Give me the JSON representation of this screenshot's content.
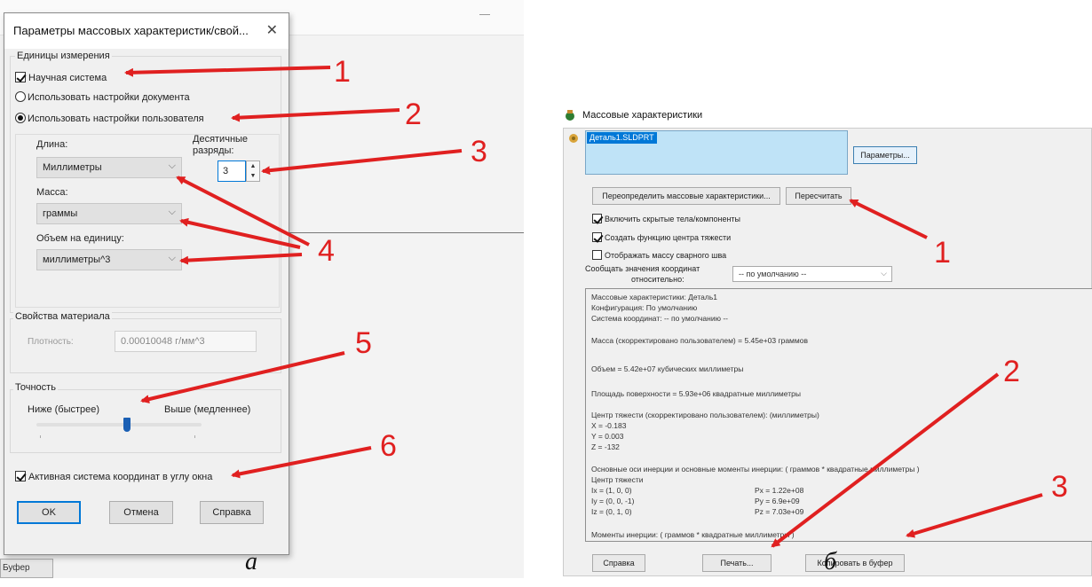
{
  "panel_a": {
    "dialog_title": "Параметры массовых характеристик/свой...",
    "close_glyph": "✕",
    "units_group_label": "Единицы измерения",
    "scientific_label": "Научная система",
    "use_document_label": "Использовать настройки документа",
    "use_user_label": "Использовать настройки пользователя",
    "length_label": "Длина:",
    "decimals_label_1": "Десятичные",
    "decimals_label_2": "разряды:",
    "length_value": "Миллиметры",
    "decimals_value": "3",
    "mass_label": "Масса:",
    "mass_value": "граммы",
    "volume_label": "Объем на единицу:",
    "volume_value": "миллиметры^3",
    "material_group_label": "Свойства материала",
    "density_label": "Плотность:",
    "density_value": "0.00010048 г/мм^3",
    "accuracy_group_label": "Точность",
    "lower_label": "Ниже (быстрее)",
    "higher_label": "Выше (медленнее)",
    "accuracy_level": 0.55,
    "active_cs_label": "Активная система координат в углу окна",
    "ok_label": "OK",
    "cancel_label": "Отмена",
    "help_label": "Справка",
    "background_button": "Буфер"
  },
  "panel_b": {
    "window_title": "Массовые характеристики",
    "selected_item": "Деталь1.SLDPRT",
    "params_button": "Параметры...",
    "override_button": "Переопределить массовые характеристики...",
    "recalc_button": "Пересчитать",
    "include_hidden_label": "Включить скрытые тела/компоненты",
    "create_cog_label": "Создать функцию центра тяжести",
    "show_weld_label": "Отображать массу сварного шва",
    "report_coord_label_1": "Сообщать значения координат",
    "report_coord_label_2": "относительно:",
    "coord_system_value": "-- по умолчанию --",
    "results": [
      "Массовые характеристики: Деталь1",
      "     Конфигурация: По умолчанию",
      "     Система координат: -- по умолчанию --",
      "Масса (скорректировано пользователем) = 5.45e+03 граммов",
      "Объем = 5.42e+07 кубических миллиметры",
      "Площадь поверхности = 5.93e+06  квадратные миллиметры",
      "Центр тяжести (скорректировано пользователем): (миллиметры)",
      "     X = -0.183",
      "     Y = 0.003",
      "     Z = -132",
      "Основные оси инерции и основные моменты инерции: ( граммов *  квадратные миллиметры )",
      "Центр тяжести",
      "     Ix = (1, 0, 0)",
      "     Iy = (0, 0, -1)",
      "     Iz = (0, 1, 0)",
      "Px = 1.22e+08",
      "Py = 6.9e+09",
      "Pz = 7.03e+09",
      "Моменты инерции: ( граммов *  квадратные миллиметры )"
    ],
    "help_button": "Справка",
    "print_button": "Печать...",
    "copy_button": "Копировать в буфер"
  },
  "captions": {
    "a": "а",
    "b": "б"
  },
  "annotations": {
    "a": [
      "1",
      "2",
      "3",
      "4",
      "5",
      "6"
    ],
    "b": [
      "1",
      "2",
      "3"
    ]
  },
  "colors": {
    "arrow": "#e02020",
    "accent": "#0078d7",
    "selection": "#bfe3f7"
  }
}
